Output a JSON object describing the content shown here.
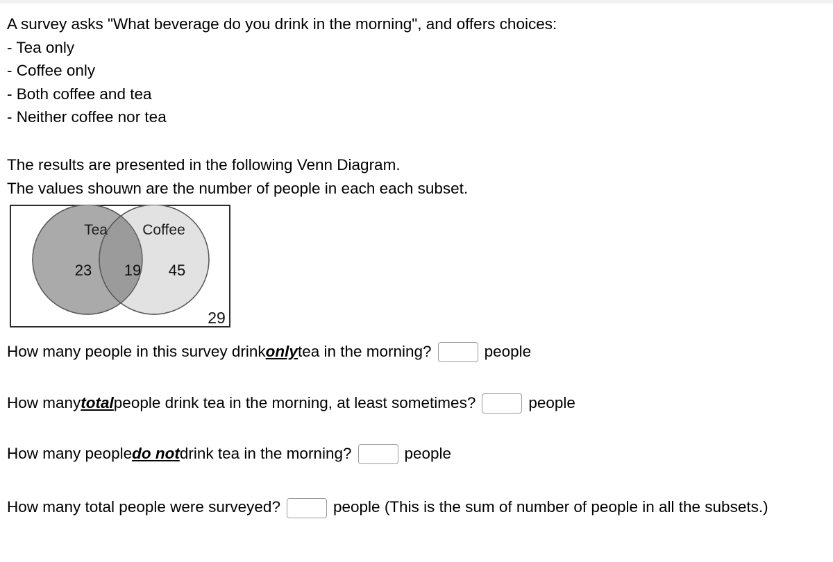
{
  "problem": {
    "intro_lines": [
      "A survey asks \"What beverage do you drink in the morning\", and offers choices:",
      "- Tea only",
      "- Coffee only",
      "- Both coffee and tea",
      "- Neither coffee nor tea"
    ],
    "results_lines": [
      "The results are presented in the following Venn Diagram.",
      "The values shouwn are the number of people in each each subset."
    ]
  },
  "venn": {
    "tea_label": "Tea",
    "coffee_label": "Coffee",
    "tea_only": "23",
    "both": "19",
    "coffee_only": "45",
    "neither": "29",
    "colors": {
      "tea_fill": "#aaaaaa",
      "coffee_fill": "#e1e1e1",
      "intersection_fill": "#9b9b9b",
      "circle_stroke": "#5a5a5a",
      "universe_stroke": "#2b2b2b"
    }
  },
  "questions": [
    {
      "before": "How many people in this survey drink ",
      "emphasis": "only",
      "after": " tea in the morning?",
      "value": "",
      "unit": "people",
      "trailing": ""
    },
    {
      "before": "How many ",
      "emphasis": "total",
      "after": " people drink tea in the morning, at least sometimes?",
      "value": "",
      "unit": "people",
      "trailing": ""
    },
    {
      "before": "How many people ",
      "emphasis": "do not",
      "after": " drink tea in the morning?",
      "value": "",
      "unit": "people",
      "trailing": ""
    },
    {
      "before": "How many total people were surveyed?",
      "emphasis": "",
      "after": "",
      "value": "",
      "unit": "people",
      "trailing": "(This is the sum of number of people in all the subsets.)"
    }
  ]
}
